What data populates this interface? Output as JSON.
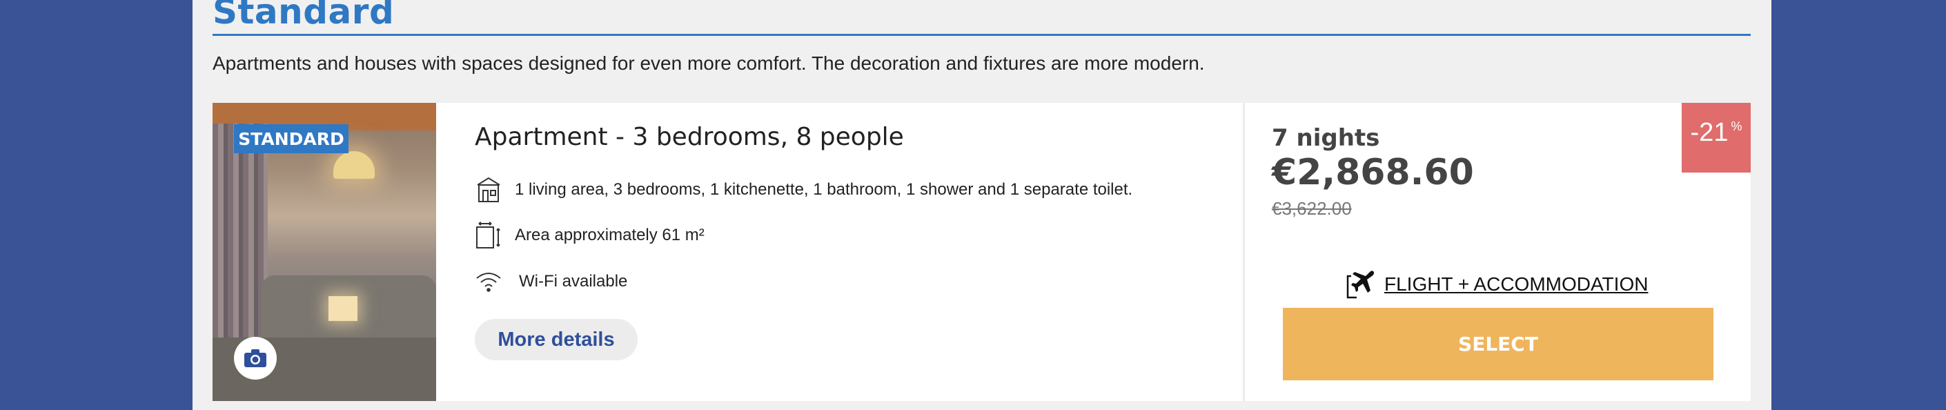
{
  "section": {
    "title": "Standard",
    "description": "Apartments and houses with spaces designed for even more comfort. The decoration and fixtures are more modern."
  },
  "offer": {
    "badge": "STANDARD",
    "title": "Apartment - 3 bedrooms, 8 people",
    "features": [
      {
        "icon": "house-icon",
        "text": "1 living area, 3 bedrooms, 1 kitchenette, 1 bathroom, 1 shower and 1 separate toilet."
      },
      {
        "icon": "area-icon",
        "text": "Area approximately 61 m²"
      },
      {
        "icon": "wifi-icon",
        "text": "Wi-Fi available"
      }
    ],
    "more_details_label": "More details",
    "nights": "7 nights",
    "price": "€2,868.60",
    "old_price": "€3,622.00",
    "discount": "-21",
    "discount_unit": "%",
    "flight_label": "FLIGHT + ACCOMMODATION",
    "select_label": "SELECT"
  },
  "colors": {
    "background": "#3a5296",
    "accent": "#2f78c4",
    "discount": "#e06c6c",
    "select": "#efb55c"
  }
}
